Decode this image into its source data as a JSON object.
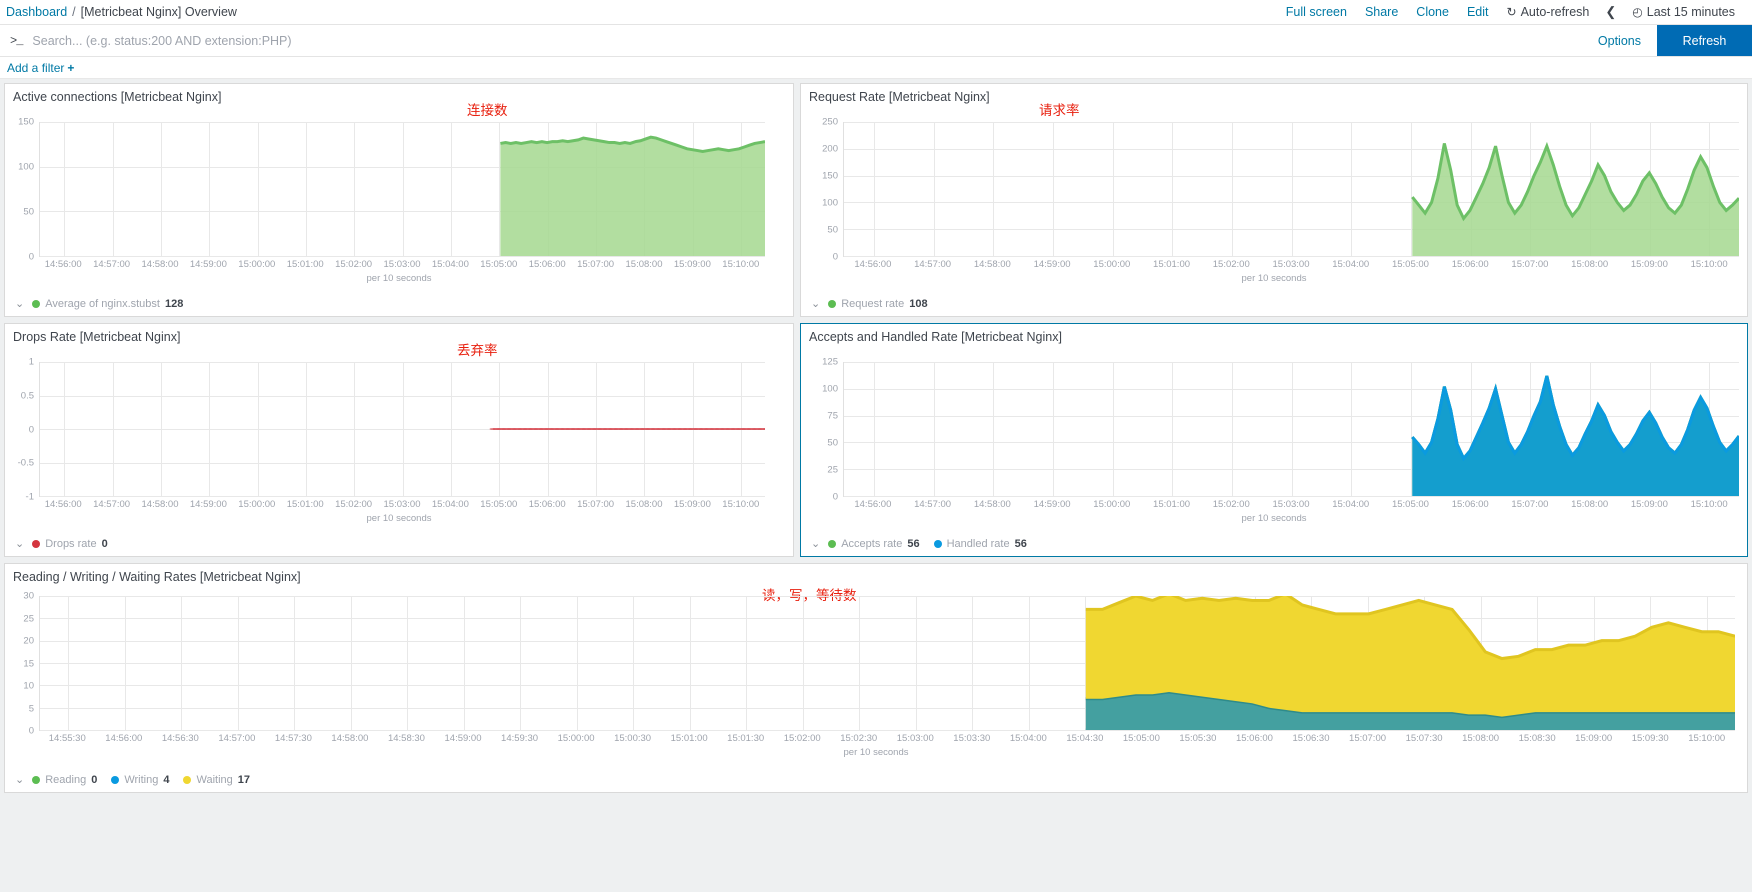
{
  "breadcrumb": {
    "root": "Dashboard",
    "separator": "/",
    "current": "[Metricbeat Nginx] Overview"
  },
  "topbar": {
    "full_screen": "Full screen",
    "share": "Share",
    "clone": "Clone",
    "edit": "Edit",
    "auto_refresh": "Auto-refresh",
    "auto_refresh_icon": "refresh-icon",
    "prev_icon": "chevron-left-icon",
    "time_icon": "clock-icon",
    "time_range": "Last 15 minutes"
  },
  "query": {
    "prompt_icon": "terminal-prompt-icon",
    "value": "",
    "placeholder": "Search... (e.g. status:200 AND extension:PHP)",
    "options_label": "Options",
    "refresh_label": "Refresh"
  },
  "filters": {
    "add_label": "Add a filter",
    "plus": "+"
  },
  "colors": {
    "accent": "#0079a5",
    "refresh_bg": "#006bb4",
    "annotation_red": "#e8200f",
    "green": "#6dc066",
    "green_fill": "#a5d88f",
    "green_dark": "#2fa84f",
    "blue": "#0a9ae0",
    "yellow": "#f0d731",
    "red": "#d4353f",
    "teal": "#44a0a0"
  },
  "panels": [
    {
      "id": "active-connections",
      "title": "Active connections [Metricbeat Nginx]",
      "annotation": "连接数",
      "legend": [
        {
          "label": "Average of nginx.stubst",
          "value": "128",
          "color": "#5cbd52"
        }
      ],
      "chart_data": {
        "type": "area",
        "title": "Active connections [Metricbeat Nginx]",
        "xlabel": "per 10 seconds",
        "ylabel": "",
        "ylim": [
          0,
          150
        ],
        "yticks": [
          0,
          50,
          100,
          150
        ],
        "ytick_labels": [
          "0",
          "50",
          "100",
          "150"
        ],
        "xticks": [
          "14:56:00",
          "14:57:00",
          "14:58:00",
          "14:59:00",
          "15:00:00",
          "15:01:00",
          "15:02:00",
          "15:03:00",
          "15:04:00",
          "15:05:00",
          "15:06:00",
          "15:07:00",
          "15:08:00",
          "15:09:00",
          "15:10:00"
        ],
        "grid": true,
        "legend_position": "bottom-left",
        "series": [
          {
            "name": "Average of nginx.stubst",
            "color": "#a5d88f",
            "line_color": "#6dc066",
            "x_start_frac": 0.635,
            "values": [
              126,
              127,
              126,
              127,
              126,
              127,
              128,
              127,
              128,
              127,
              128,
              128,
              129,
              128,
              129,
              130,
              132,
              131,
              130,
              129,
              128,
              127,
              127,
              126,
              127,
              126,
              128,
              129,
              131,
              133,
              132,
              130,
              128,
              126,
              124,
              122,
              120,
              119,
              118,
              117,
              118,
              119,
              120,
              119,
              118,
              119,
              120,
              122,
              124,
              126,
              127,
              128
            ]
          }
        ]
      }
    },
    {
      "id": "request-rate",
      "title": "Request Rate [Metricbeat Nginx]",
      "annotation": "请求率",
      "legend": [
        {
          "label": "Request rate",
          "value": "108",
          "color": "#5cbd52"
        }
      ],
      "chart_data": {
        "type": "area",
        "title": "Request Rate [Metricbeat Nginx]",
        "xlabel": "per 10 seconds",
        "ylabel": "",
        "ylim": [
          0,
          250
        ],
        "yticks": [
          0,
          50,
          100,
          150,
          200,
          250
        ],
        "ytick_labels": [
          "0",
          "50",
          "100",
          "150",
          "200",
          "250"
        ],
        "xticks": [
          "14:56:00",
          "14:57:00",
          "14:58:00",
          "14:59:00",
          "15:00:00",
          "15:01:00",
          "15:02:00",
          "15:03:00",
          "15:04:00",
          "15:05:00",
          "15:06:00",
          "15:07:00",
          "15:08:00",
          "15:09:00",
          "15:10:00"
        ],
        "grid": true,
        "legend_position": "bottom-left",
        "series": [
          {
            "name": "Request rate",
            "color": "#a5d88f",
            "line_color": "#6dc066",
            "x_start_frac": 0.635,
            "values": [
              110,
              95,
              80,
              100,
              145,
              210,
              160,
              95,
              70,
              85,
              110,
              135,
              165,
              205,
              150,
              100,
              80,
              95,
              120,
              150,
              175,
              205,
              170,
              130,
              95,
              75,
              90,
              115,
              140,
              170,
              150,
              120,
              100,
              85,
              95,
              115,
              140,
              155,
              135,
              110,
              90,
              80,
              95,
              125,
              160,
              185,
              165,
              130,
              100,
              85,
              95,
              108
            ]
          }
        ]
      }
    },
    {
      "id": "drops-rate",
      "title": "Drops Rate [Metricbeat Nginx]",
      "annotation": "丢弃率",
      "legend": [
        {
          "label": "Drops rate",
          "value": "0",
          "color": "#d4353f"
        }
      ],
      "chart_data": {
        "type": "line",
        "title": "Drops Rate [Metricbeat Nginx]",
        "xlabel": "per 10 seconds",
        "ylabel": "",
        "ylim": [
          -1,
          1
        ],
        "yticks": [
          -1,
          -0.5,
          0,
          0.5,
          1
        ],
        "ytick_labels": [
          "-1",
          "-0.5",
          "0",
          "0.5",
          "1"
        ],
        "xticks": [
          "14:56:00",
          "14:57:00",
          "14:58:00",
          "14:59:00",
          "15:00:00",
          "15:01:00",
          "15:02:00",
          "15:03:00",
          "15:04:00",
          "15:05:00",
          "15:06:00",
          "15:07:00",
          "15:08:00",
          "15:09:00",
          "15:10:00"
        ],
        "grid": true,
        "legend_position": "bottom-left",
        "series": [
          {
            "name": "Drops rate",
            "color": "#d4353f",
            "line_color": "#d4353f",
            "x_start_frac": 0.625,
            "values": [
              0,
              0,
              0,
              0,
              0,
              0,
              0,
              0,
              0,
              0,
              0,
              0,
              0,
              0,
              0,
              0,
              0,
              0,
              0,
              0,
              0,
              0,
              0,
              0,
              0,
              0,
              0,
              0,
              0,
              0,
              0,
              0,
              0,
              0,
              0,
              0,
              0,
              0,
              0,
              0,
              0,
              0,
              0,
              0,
              0,
              0,
              0,
              0,
              0,
              0,
              0,
              0
            ]
          }
        ]
      }
    },
    {
      "id": "accepts-handled-rate",
      "title": "Accepts and Handled Rate [Metricbeat Nginx]",
      "annotation": "",
      "selected": true,
      "legend": [
        {
          "label": "Accepts rate",
          "value": "56",
          "color": "#5cbd52"
        },
        {
          "label": "Handled rate",
          "value": "56",
          "color": "#0a9ae0"
        }
      ],
      "chart_data": {
        "type": "area",
        "title": "Accepts and Handled Rate [Metricbeat Nginx]",
        "xlabel": "per 10 seconds",
        "ylabel": "",
        "ylim": [
          0,
          125
        ],
        "yticks": [
          0,
          25,
          50,
          75,
          100,
          125
        ],
        "ytick_labels": [
          "0",
          "25",
          "50",
          "75",
          "100",
          "125"
        ],
        "xticks": [
          "14:56:00",
          "14:57:00",
          "14:58:00",
          "14:59:00",
          "15:00:00",
          "15:01:00",
          "15:02:00",
          "15:03:00",
          "15:04:00",
          "15:05:00",
          "15:06:00",
          "15:07:00",
          "15:08:00",
          "15:09:00",
          "15:10:00"
        ],
        "grid": true,
        "legend_position": "bottom-left",
        "series": [
          {
            "name": "Accepts rate",
            "color": "#2fa84f",
            "line_color": "#2fa84f",
            "x_start_frac": 0.635,
            "values": [
              55,
              48,
              40,
              50,
              72,
              102,
              80,
              48,
              35,
              42,
              55,
              68,
              82,
              100,
              75,
              50,
              40,
              48,
              60,
              75,
              88,
              112,
              85,
              65,
              48,
              38,
              45,
              58,
              70,
              85,
              75,
              60,
              50,
              42,
              48,
              58,
              70,
              78,
              68,
              55,
              45,
              40,
              48,
              62,
              80,
              92,
              82,
              65,
              50,
              42,
              48,
              56
            ]
          },
          {
            "name": "Handled rate",
            "color": "#0a9ae0",
            "line_color": "#0a9ae0",
            "x_start_frac": 0.635,
            "values": [
              55,
              48,
              40,
              50,
              72,
              102,
              80,
              48,
              35,
              42,
              55,
              68,
              82,
              100,
              75,
              50,
              40,
              48,
              60,
              75,
              88,
              112,
              85,
              65,
              48,
              38,
              45,
              58,
              70,
              85,
              75,
              60,
              50,
              42,
              48,
              58,
              70,
              78,
              68,
              55,
              45,
              40,
              48,
              62,
              80,
              92,
              82,
              65,
              50,
              42,
              48,
              56
            ]
          }
        ]
      }
    },
    {
      "id": "reading-writing-waiting-rates",
      "title": "Reading / Writing / Waiting Rates [Metricbeat Nginx]",
      "annotation": "读，写，等待数",
      "legend": [
        {
          "label": "Reading",
          "value": "0",
          "color": "#5cbd52"
        },
        {
          "label": "Writing",
          "value": "4",
          "color": "#0a9ae0"
        },
        {
          "label": "Waiting",
          "value": "17",
          "color": "#f0d731"
        }
      ],
      "chart_data": {
        "type": "area",
        "stacked": true,
        "title": "Reading / Writing / Waiting Rates [Metricbeat Nginx]",
        "xlabel": "per 10 seconds",
        "ylabel": "",
        "ylim": [
          0,
          30
        ],
        "yticks": [
          0,
          5,
          10,
          15,
          20,
          25,
          30
        ],
        "ytick_labels": [
          "0",
          "5",
          "10",
          "15",
          "20",
          "25",
          "30"
        ],
        "xticks": [
          "14:55:30",
          "14:56:00",
          "14:56:30",
          "14:57:00",
          "14:57:30",
          "14:58:00",
          "14:58:30",
          "14:59:00",
          "14:59:30",
          "15:00:00",
          "15:00:30",
          "15:01:00",
          "15:01:30",
          "15:02:00",
          "15:02:30",
          "15:03:00",
          "15:03:30",
          "15:04:00",
          "15:04:30",
          "15:05:00",
          "15:05:30",
          "15:06:00",
          "15:06:30",
          "15:07:00",
          "15:07:30",
          "15:08:00",
          "15:08:30",
          "15:09:00",
          "15:09:30",
          "15:10:00"
        ],
        "grid": true,
        "legend_position": "bottom-left",
        "series": [
          {
            "name": "Reading",
            "color": "#44a0a0",
            "line_color": "#44a0a0",
            "x_start_frac": 0.617,
            "values": [
              0,
              0,
              0,
              0,
              0,
              0,
              0,
              0,
              0,
              0,
              0,
              0,
              0,
              0,
              0,
              0,
              0,
              0,
              0,
              0,
              0,
              0,
              0,
              0,
              0,
              0,
              0,
              0,
              0,
              0,
              0,
              0,
              0,
              0,
              0,
              0,
              0,
              0,
              0,
              0
            ]
          },
          {
            "name": "Writing",
            "color": "#44a0a0",
            "line_color": "#2e8b8b",
            "x_start_frac": 0.617,
            "values": [
              7,
              7,
              7.5,
              8,
              8,
              8.5,
              8,
              7.5,
              7,
              6.5,
              6,
              5,
              4.5,
              4,
              4,
              4,
              4,
              4,
              4,
              4,
              4,
              4,
              4,
              3.5,
              3.5,
              3,
              3.5,
              4,
              4,
              4,
              4,
              4,
              4,
              4,
              4,
              4,
              4,
              4,
              4,
              4
            ]
          },
          {
            "name": "Waiting",
            "color": "#f0d731",
            "line_color": "#e0c520",
            "x_start_frac": 0.617,
            "values": [
              20,
              20,
              21,
              22,
              21,
              22,
              21,
              22,
              22,
              23,
              23,
              24,
              26,
              24,
              23,
              22,
              22,
              22,
              23,
              24,
              25,
              24,
              23,
              19,
              14,
              13,
              13,
              14,
              14,
              15,
              15,
              16,
              16,
              17,
              19,
              20,
              19,
              18,
              18,
              17
            ]
          }
        ]
      }
    }
  ]
}
